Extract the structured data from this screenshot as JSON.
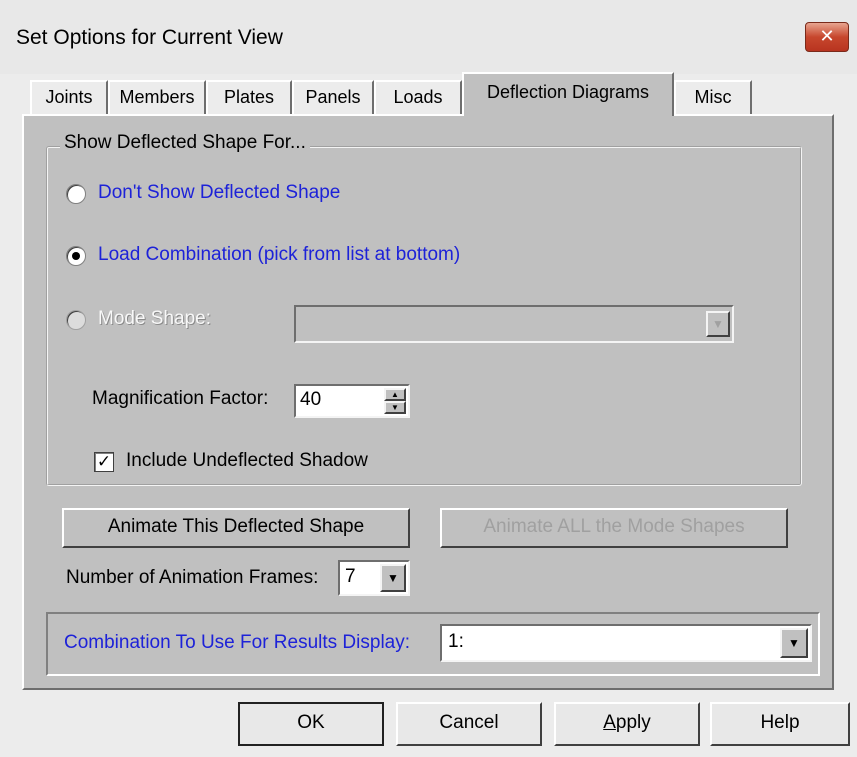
{
  "window": {
    "title": "Set Options for Current View",
    "close_glyph": "✕"
  },
  "tabs": [
    {
      "label": "Joints"
    },
    {
      "label": "Members"
    },
    {
      "label": "Plates"
    },
    {
      "label": "Panels"
    },
    {
      "label": "Loads"
    },
    {
      "label": "Deflection Diagrams",
      "active": true
    },
    {
      "label": "Misc"
    }
  ],
  "group": {
    "title": "Show Deflected Shape For...",
    "radios": [
      {
        "label": "Don't Show Deflected Shape",
        "selected": false,
        "enabled": true
      },
      {
        "label": "Load Combination (pick from list at bottom)",
        "selected": true,
        "enabled": true
      },
      {
        "label": "Mode Shape:",
        "selected": false,
        "enabled": false
      }
    ],
    "mode_shape_value": "",
    "magnification": {
      "label": "Magnification Factor:",
      "value": "40"
    },
    "shadow_checkbox": {
      "label": "Include Undeflected Shadow",
      "checked": true
    }
  },
  "animate_buttons": {
    "this_shape": "Animate This Deflected Shape",
    "all_modes": "Animate ALL the Mode Shapes"
  },
  "frames": {
    "label": "Number of Animation Frames:",
    "value": "7"
  },
  "combination": {
    "label": "Combination To Use For Results Display:",
    "value": "1:"
  },
  "footer": {
    "ok": "OK",
    "cancel": "Cancel",
    "apply": "Apply",
    "help": "Help"
  },
  "colors": {
    "accent_text": "#1d22d8",
    "panel": "#c0c0c0",
    "close_button": "#c7472d"
  }
}
